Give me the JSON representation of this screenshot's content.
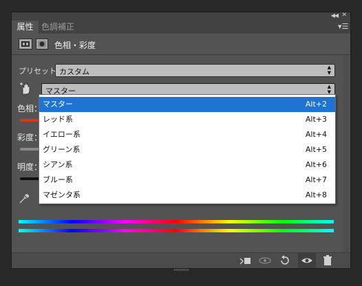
{
  "panel": {
    "tabs": [
      "属性",
      "色調補正"
    ],
    "header_title": "色相・彩度",
    "preset_label": "プリセット：",
    "preset_value": "カスタム",
    "channel_value": "マスター",
    "labels": {
      "hue": "色相：",
      "saturation": "彩度：",
      "lightness": "明度："
    }
  },
  "dropdown": {
    "items": [
      {
        "label": "マスター",
        "shortcut": "Alt+2",
        "selected": true
      },
      {
        "label": "レッド系",
        "shortcut": "Alt+3",
        "selected": false
      },
      {
        "label": "イエロー系",
        "shortcut": "Alt+4",
        "selected": false
      },
      {
        "label": "グリーン系",
        "shortcut": "Alt+5",
        "selected": false
      },
      {
        "label": "シアン系",
        "shortcut": "Alt+6",
        "selected": false
      },
      {
        "label": "ブルー系",
        "shortcut": "Alt+7",
        "selected": false
      },
      {
        "label": "マゼンタ系",
        "shortcut": "Alt+8",
        "selected": false
      }
    ]
  },
  "icons": {
    "panel_collapse": "double-chevron-left-icon",
    "panel_close": "close-icon",
    "panel_menu": "panel-menu-icon",
    "adjustment_layer": "hue-saturation-layer-icon",
    "mask": "mask-icon",
    "targeted_adjust": "hand-target-icon",
    "eyedropper": "eyedropper-icon",
    "clip": "clip-to-layer-icon",
    "view_previous": "view-previous-icon",
    "reset": "reset-icon",
    "visibility": "eye-icon",
    "delete": "trash-icon"
  },
  "colors": {
    "selection": "#1e74d0",
    "panel_bg": "#535353"
  }
}
